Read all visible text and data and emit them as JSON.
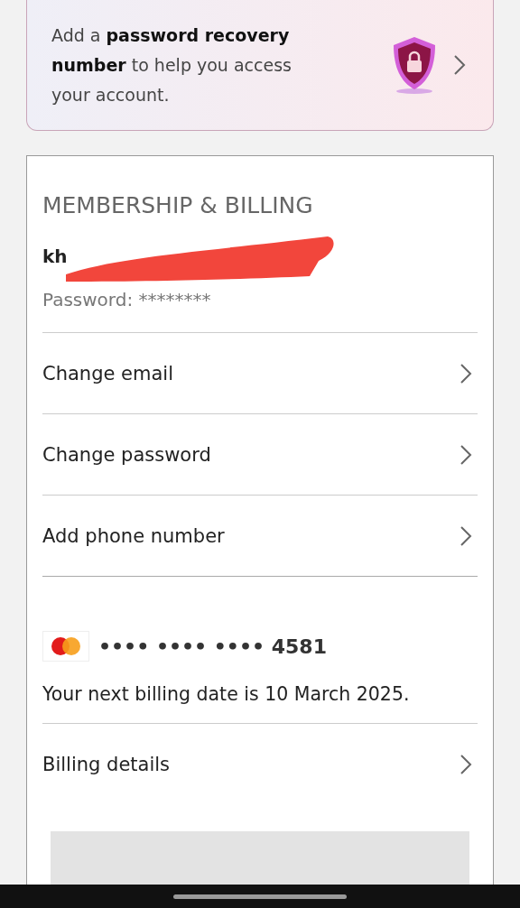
{
  "recovery_banner": {
    "text": "Add a **password recovery number** to help you access your account."
  },
  "membership": {
    "title": "MEMBERSHIP & BILLING",
    "email": "kh",
    "password_label": "Password: ********",
    "links": [
      {
        "label": "Change email"
      },
      {
        "label": "Change password"
      },
      {
        "label": "Add phone number"
      }
    ],
    "card_number": "•••• •••• •••• 4581",
    "billing_date": "Your next billing date is 10 March 2025.",
    "billing_link": {
      "label": "Billing details"
    }
  }
}
